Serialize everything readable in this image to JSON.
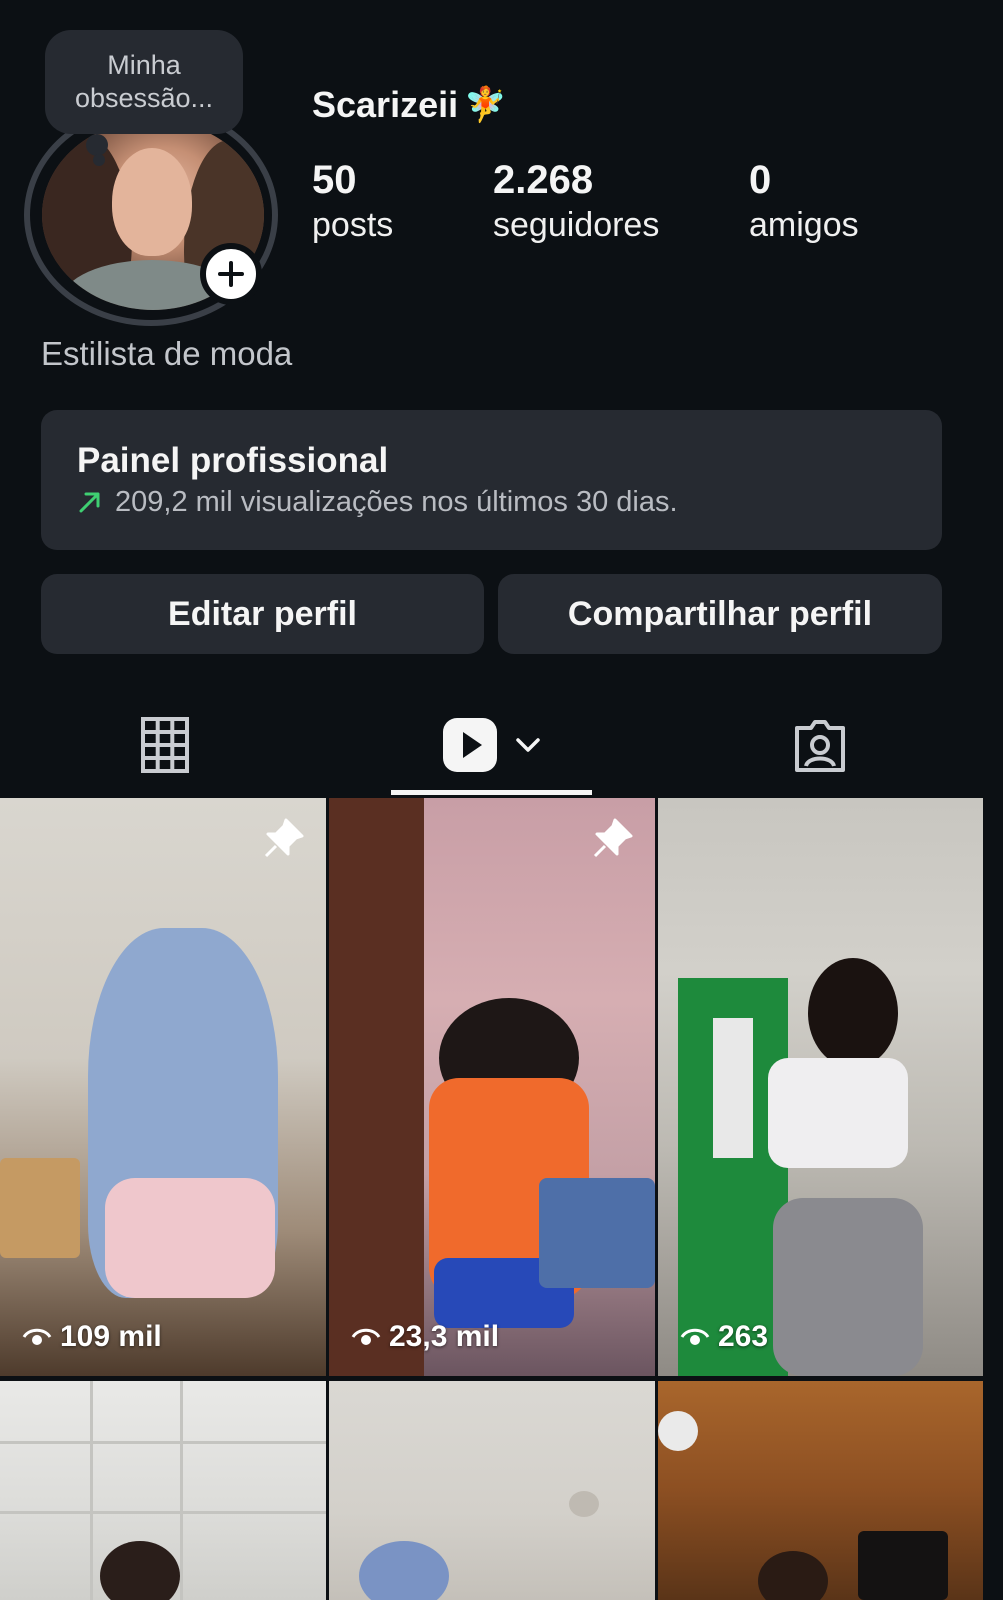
{
  "profile": {
    "note": [
      "Minha",
      "obsessão..."
    ],
    "username": "Scarizeii",
    "username_emoji": "🧚",
    "bio": "Estilista de moda",
    "stats": [
      {
        "value": "50",
        "label": "posts"
      },
      {
        "value": "2.268",
        "label": "seguidores"
      },
      {
        "value": "0",
        "label": "amigos"
      }
    ]
  },
  "pro_panel": {
    "title": "Painel profissional",
    "subtitle": "209,2 mil visualizações nos últimos 30 dias."
  },
  "buttons": {
    "edit": "Editar perfil",
    "share": "Compartilhar perfil"
  },
  "tabs": [
    {
      "icon": "grid-icon",
      "active": false
    },
    {
      "icon": "reels-icon",
      "active": true
    },
    {
      "icon": "tagged-icon",
      "active": false
    }
  ],
  "grid": [
    {
      "views": "109 mil",
      "pinned": true
    },
    {
      "views": "23,3 mil",
      "pinned": true
    },
    {
      "views": "263",
      "pinned": false
    },
    {
      "views": "",
      "pinned": false
    },
    {
      "views": "",
      "pinned": false
    },
    {
      "views": "",
      "pinned": false
    }
  ],
  "colors": {
    "background": "#0c1014",
    "panel": "#262a31",
    "accent_green": "#3fcf72"
  }
}
